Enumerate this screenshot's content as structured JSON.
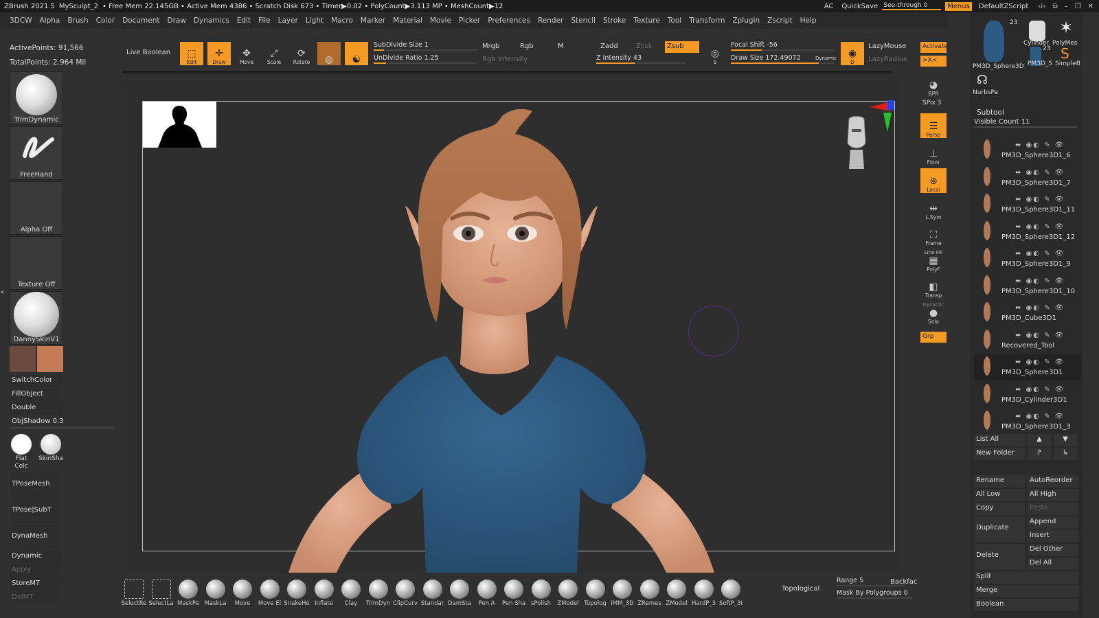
{
  "title": {
    "app": "ZBrush 2021.5",
    "doc": "MySculpt_2",
    "status": "• Free Mem 22.145GB • Active Mem 4386 • Scratch Disk 673 • Timer▶0.02 • PolyCount▶3.113 MP • MeshCount▶12",
    "ac": "AC",
    "quicksave": "QuickSave",
    "seethrough": "See-through  0",
    "menus": "Menus",
    "script": "DefaultZScript"
  },
  "menubar": [
    "3DCW",
    "Alpha",
    "Brush",
    "Color",
    "Document",
    "Draw",
    "Dynamics",
    "Edit",
    "File",
    "Layer",
    "Light",
    "Macro",
    "Marker",
    "Material",
    "Movie",
    "Picker",
    "Preferences",
    "Render",
    "Stencil",
    "Stroke",
    "Texture",
    "Tool",
    "Transform",
    "Zplugin",
    "Zscript",
    "Help"
  ],
  "info": {
    "active_points": "ActivePoints: 91,566",
    "total_points": "TotalPoints: 2.964 Mil"
  },
  "toolbar": {
    "live_boolean": "Live Boolean",
    "edit": "Edit",
    "draw": "Draw",
    "move": "Move",
    "scale": "Scale",
    "rotate": "Rotate",
    "subdivide": "SubDivide Size 1",
    "undivide": "UnDivide Ratio 1.25",
    "mrgb": "Mrgb",
    "rgb": "Rgb",
    "m": "M",
    "rgb_intensity": "Rgb Intensity",
    "zadd": "Zadd",
    "zcut": "Zcut",
    "zsub": "Zsub",
    "z_intensity": "Z Intensity 43",
    "focal_shift": "Focal Shift -56",
    "draw_size": "Draw Size 172.49072",
    "dynamic": "Dynamic",
    "lazymouse": "LazyMouse",
    "lazyradius": "LazyRadius",
    "s_label": "S",
    "d_label": "D",
    "subdivide_level": 0.1,
    "undivide_level": 0.12,
    "z_intensity_level": 0.43,
    "focal_level": 0.3,
    "drawsize_level": 0.85
  },
  "left": {
    "brush1": "TrimDynamic",
    "brush2": "FreeHand",
    "alpha": "Alpha Off",
    "texture": "Texture Off",
    "material": "DannySkinV1",
    "switch_color": "SwitchColor",
    "fill_object": "FillObject",
    "double": "Double",
    "obj_shadow": "ObjShadow 0.3",
    "flat_color": "Flat Colc",
    "skin_shade": "SkinSha",
    "tpose_mesh": "TPoseMesh",
    "tpose_subt": "TPose|SubT",
    "dynamesh": "DynaMesh",
    "dynamic": "Dynamic",
    "apply": "Apply",
    "storemt": "StoreMT",
    "delmt": "DelMT",
    "color_primary": "#6b4a40",
    "color_secondary": "#c47a55"
  },
  "right_shelf": {
    "bpr": "BPR",
    "spix": "SPix 3",
    "persp": "Persp",
    "floor": "Floor",
    "local": "Local",
    "lsym": "L.Sym",
    "frame": "Frame",
    "linefill": "Line Fill",
    "polyf": "PolyF",
    "transp": "Transp",
    "dynamic": "Dynamic",
    "solo": "Solo",
    "grp": "Grp",
    "activate": "Activate",
    "xc": ">X<"
  },
  "subtool": {
    "top_items": [
      {
        "name": "PM3D_Sphere3D",
        "count": "23"
      },
      {
        "name": "Cylinder",
        "count": ""
      },
      {
        "name": "PolyMes",
        "count": ""
      },
      {
        "name": "PM3D_S",
        "count": "23"
      },
      {
        "name": "SimpleB",
        "count": ""
      },
      {
        "name": "NurbsPa",
        "count": ""
      }
    ],
    "header": "Subtool",
    "visible_count": "Visible Count 11",
    "rows": [
      {
        "name": "PM3D_Sphere3D1_6",
        "sel": false
      },
      {
        "name": "PM3D_Sphere3D1_7",
        "sel": false
      },
      {
        "name": "PM3D_Sphere3D1_11",
        "sel": false
      },
      {
        "name": "PM3D_Sphere3D1_12",
        "sel": false
      },
      {
        "name": "PM3D_Sphere3D1_9",
        "sel": false
      },
      {
        "name": "PM3D_Sphere3D1_10",
        "sel": false
      },
      {
        "name": "PM3D_Cube3D1",
        "sel": false
      },
      {
        "name": "Recovered_Tool",
        "sel": false
      },
      {
        "name": "PM3D_Sphere3D1",
        "sel": true
      },
      {
        "name": "PM3D_Cylinder3D1",
        "sel": false
      },
      {
        "name": "PM3D_Sphere3D1_3",
        "sel": false
      }
    ],
    "list_all": "List All",
    "new_folder": "New Folder",
    "rename": "Rename",
    "autoreorder": "AutoReorder",
    "all_low": "All Low",
    "all_high": "All High",
    "copy": "Copy",
    "paste": "Paste",
    "duplicate": "Duplicate",
    "append": "Append",
    "insert": "Insert",
    "delete": "Delete",
    "del_other": "Del Other",
    "del_all": "Del All",
    "split": "Split",
    "merge": "Merge",
    "boolean": "Boolean"
  },
  "bottom": {
    "brushes": [
      "SelectRe",
      "SelectLa",
      "MaskPe",
      "MaskLa",
      "Move",
      "Move El",
      "SnakeHo",
      "Inflate",
      "Clay",
      "TrimDyn",
      "ClipCurv",
      "Standar",
      "DamSta",
      "Pen A",
      "Pen Sha",
      "sPolish",
      "ZModel",
      "Topolog",
      "IMM_3D",
      "ZRemes",
      "ZModel",
      "HardP_3",
      "SoftP_3I"
    ],
    "topological": "Topological",
    "range": "Range 5",
    "backface": "Backfac",
    "mask_by_polygroups": "Mask By Polygroups 0"
  }
}
